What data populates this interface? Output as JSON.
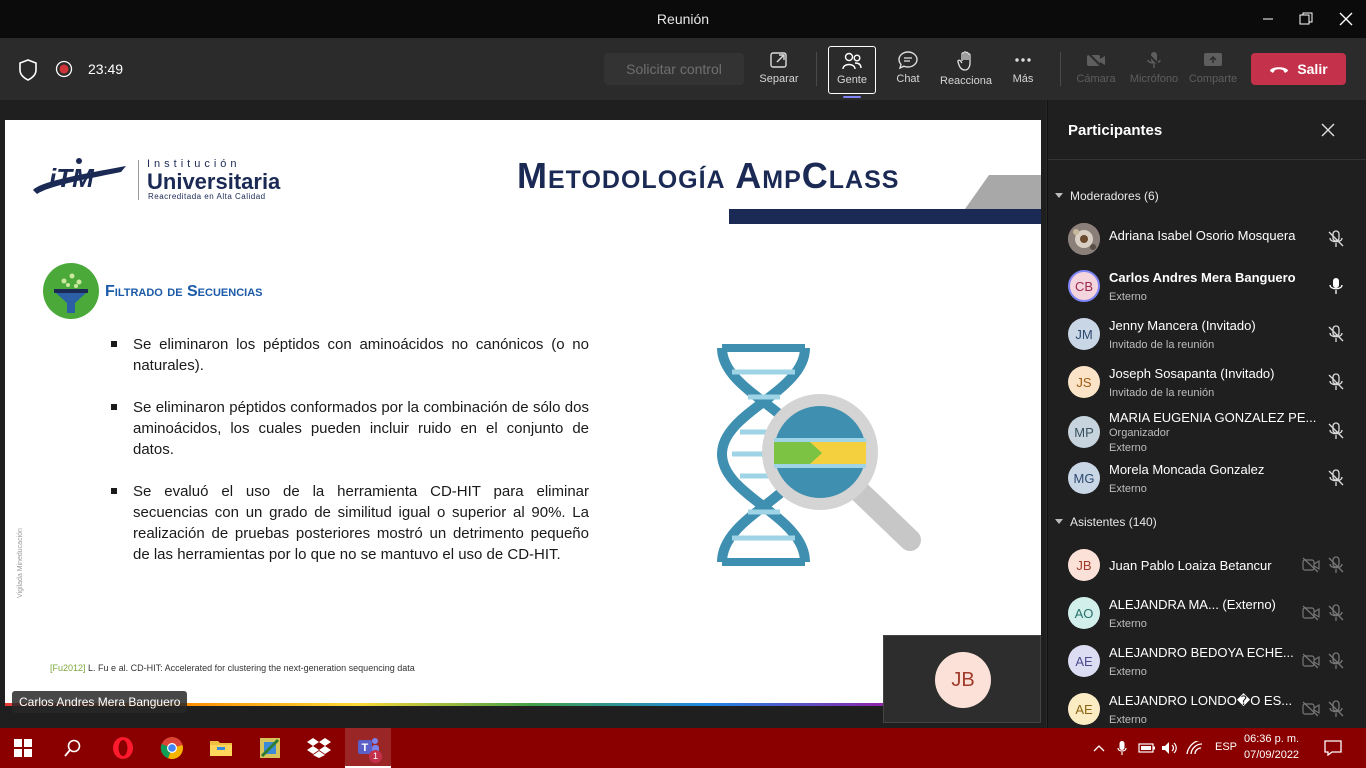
{
  "window": {
    "title": "Reunión"
  },
  "toolbar": {
    "timer": "23:49",
    "request_control": "Solicitar control",
    "separar": "Separar",
    "gente": "Gente",
    "chat": "Chat",
    "reacciona": "Reacciona",
    "mas": "Más",
    "camara": "Cámara",
    "microfono": "Micrófono",
    "comparte": "Comparte",
    "salir": "Salir"
  },
  "slide": {
    "title": "Metodología AmpClass",
    "logo_top": "Institución",
    "logo_main": "Universitaria",
    "logo_sub": "Reacreditada en Alta Calidad",
    "section": "Filtrado de Secuencias",
    "bullets": [
      "Se eliminaron los péptidos con aminoácidos no canónicos (o no naturales).",
      "Se eliminaron péptidos conformados por la combinación de sólo dos aminoácidos, los cuales pueden incluir ruido en el conjunto de datos.",
      "Se evaluó el uso de la herramienta CD-HIT para eliminar secuencias con un grado de similitud igual o superior al 90%. La realización de pruebas posteriores mostró un detrimento pequeño de las herramientas por lo que no se mantuvo el uso de CD-HIT."
    ],
    "ref_tag": "[Fu2012]",
    "ref_text": "L. Fu e al. CD-HIT:  Accelerated  for  clustering  the  next-generation sequencing data",
    "watermark": "Vigilada Mineducación"
  },
  "presenter_label": "Carlos Andres Mera Banguero",
  "self_view_initials": "JB",
  "panel": {
    "title": "Participantes",
    "moderators_header": "Moderadores (6)",
    "attendees_header": "Asistentes (140)",
    "moderators": [
      {
        "initials": "",
        "name": "Adriana Isabel Osorio Mosquera",
        "sub1": "",
        "sub2": "",
        "color": "#6b6b6b"
      },
      {
        "initials": "CB",
        "name": "Carlos Andres Mera Banguero",
        "sub1": "Externo",
        "sub2": "",
        "color": "#f4d4dd"
      },
      {
        "initials": "JM",
        "name": "Jenny Mancera (Invitado)",
        "sub1": "Invitado de la reunión",
        "sub2": "",
        "color": "#c9d6e6"
      },
      {
        "initials": "JS",
        "name": "Joseph Sosapanta (Invitado)",
        "sub1": "Invitado de la reunión",
        "sub2": "",
        "color": "#fbe3c7"
      },
      {
        "initials": "MP",
        "name": "MARIA EUGENIA GONZALEZ PE...",
        "sub1": "Organizador",
        "sub2": "Externo",
        "color": "#c7d4dd"
      },
      {
        "initials": "MG",
        "name": "Morela Moncada Gonzalez",
        "sub1": "Externo",
        "sub2": "",
        "color": "#c9d6e6"
      }
    ],
    "attendees": [
      {
        "initials": "JB",
        "name": "Juan Pablo Loaiza Betancur",
        "sub1": "",
        "color": "#fbe1d8"
      },
      {
        "initials": "AO",
        "name": "ALEJANDRA MA...  (Externo)",
        "sub1": "Externo",
        "color": "#d2efec"
      },
      {
        "initials": "AE",
        "name": "ALEJANDRO BEDOYA ECHE...",
        "sub1": "Externo",
        "color": "#dcdcf2"
      },
      {
        "initials": "AE",
        "name": "ALEJANDRO LONDO�O ES...",
        "sub1": "Externo",
        "color": "#fbecc4"
      }
    ]
  },
  "taskbar": {
    "time": "06:36 p. m.",
    "date": "07/09/2022",
    "lang": "ESP",
    "teams_badge": "1"
  }
}
